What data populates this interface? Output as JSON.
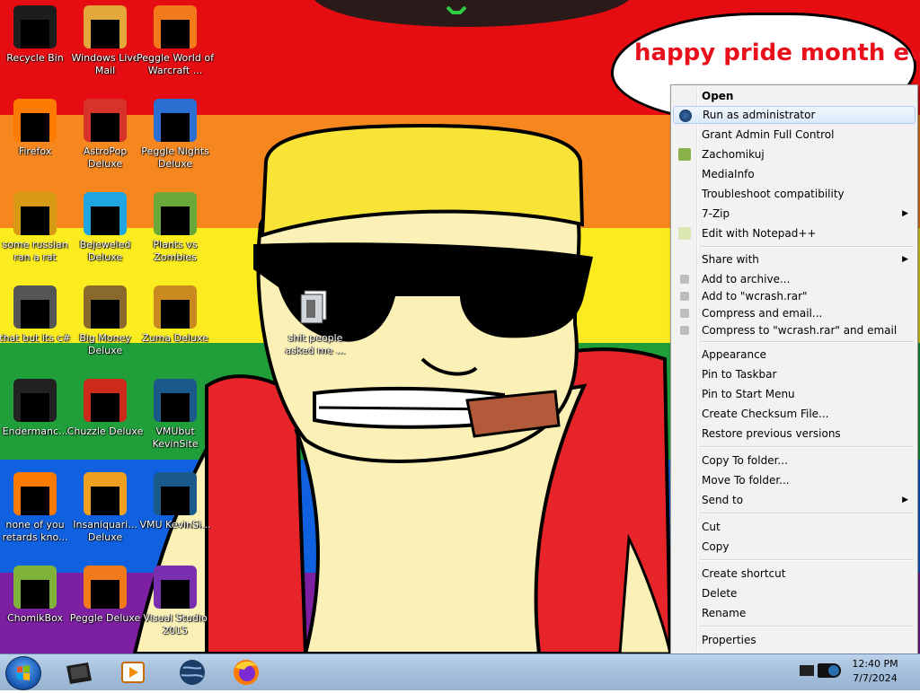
{
  "wallpaper": {
    "stripe_colors": [
      "#e50d12",
      "#f6861e",
      "#fbec1f",
      "#1f9e3a",
      "#1061df",
      "#7c1fa0"
    ]
  },
  "bubble": {
    "text": "happy pride month eve"
  },
  "desktop_icons": [
    {
      "label": "Recycle Bin",
      "icon": "recycle-bin-icon"
    },
    {
      "label": "Windows Live Mail",
      "icon": "mail-icon"
    },
    {
      "label": "Peggle World of Warcraft ...",
      "icon": "peggle-icon"
    },
    {
      "label": "Firefox",
      "icon": "firefox-icon"
    },
    {
      "label": "AstroPop Deluxe",
      "icon": "astropop-icon"
    },
    {
      "label": "Peggle Nights Deluxe",
      "icon": "peggle-nights-icon"
    },
    {
      "label": "some russian ran a rat",
      "icon": "app-icon"
    },
    {
      "label": "Bejeweled Deluxe",
      "icon": "bejeweled-icon"
    },
    {
      "label": "Plants vs Zombies",
      "icon": "plants-vs-zombies-icon"
    },
    {
      "label": "that but its c#",
      "icon": "windows-stack-icon"
    },
    {
      "label": "Big Money Deluxe",
      "icon": "money-bag-icon"
    },
    {
      "label": "Zuma Deluxe",
      "icon": "zuma-icon"
    },
    {
      "label": "Endermanc...",
      "icon": "terminal-icon"
    },
    {
      "label": "Chuzzle Deluxe",
      "icon": "chuzzle-icon"
    },
    {
      "label": "VMUbut KevinSite",
      "icon": "vm-icon"
    },
    {
      "label": "none of you retards kno...",
      "icon": "firefox-icon"
    },
    {
      "label": "Insaniquari... Deluxe",
      "icon": "fish-icon"
    },
    {
      "label": "VMU KevinSi...",
      "icon": "vm-icon"
    },
    {
      "label": "ChomikBox",
      "icon": "chomikbox-icon"
    },
    {
      "label": "Peggle Deluxe",
      "icon": "peggle-icon"
    },
    {
      "label": "Visual Studio 2015",
      "icon": "visual-studio-icon"
    }
  ],
  "selected_file": {
    "label": "shit people asked me ...",
    "icon": "file-icon"
  },
  "context_menu": {
    "items": [
      {
        "label": "Open",
        "bold": true
      },
      {
        "label": "Run as administrator",
        "icon": "shield-icon",
        "highlighted": true
      },
      {
        "label": "Grant Admin Full Control"
      },
      {
        "label": "Zachomikuj",
        "icon": "chomik-icon"
      },
      {
        "label": "MediaInfo"
      },
      {
        "label": "Troubleshoot compatibility"
      },
      {
        "label": "7-Zip",
        "submenu": true
      },
      {
        "label": "Edit with Notepad++",
        "icon": "notepad-icon"
      },
      {
        "label": "Share with",
        "submenu": true
      },
      {
        "label": "Add to archive...",
        "icon": "archive-icon"
      },
      {
        "label": "Add to \"wcrash.rar\"",
        "icon": "archive-icon"
      },
      {
        "label": "Compress and email...",
        "icon": "archive-icon"
      },
      {
        "label": "Compress to \"wcrash.rar\" and email",
        "icon": "archive-icon"
      },
      {
        "label": "Appearance"
      },
      {
        "label": "Pin to Taskbar"
      },
      {
        "label": "Pin to Start Menu"
      },
      {
        "label": "Create Checksum File..."
      },
      {
        "label": "Restore previous versions"
      },
      {
        "label": "Copy To folder..."
      },
      {
        "label": "Move To folder..."
      },
      {
        "label": "Send to",
        "submenu": true
      },
      {
        "label": "Cut"
      },
      {
        "label": "Copy"
      },
      {
        "label": "Create shortcut"
      },
      {
        "label": "Delete"
      },
      {
        "label": "Rename"
      },
      {
        "label": "Properties"
      }
    ]
  },
  "taskbar": {
    "pinned": [
      "explorer-icon",
      "media-player-icon",
      "globe-icon",
      "firefox-icon"
    ],
    "tray": [
      "network-icon",
      "camera-icon"
    ],
    "clock": {
      "time": "12:40 PM",
      "date": "7/7/2024"
    }
  }
}
